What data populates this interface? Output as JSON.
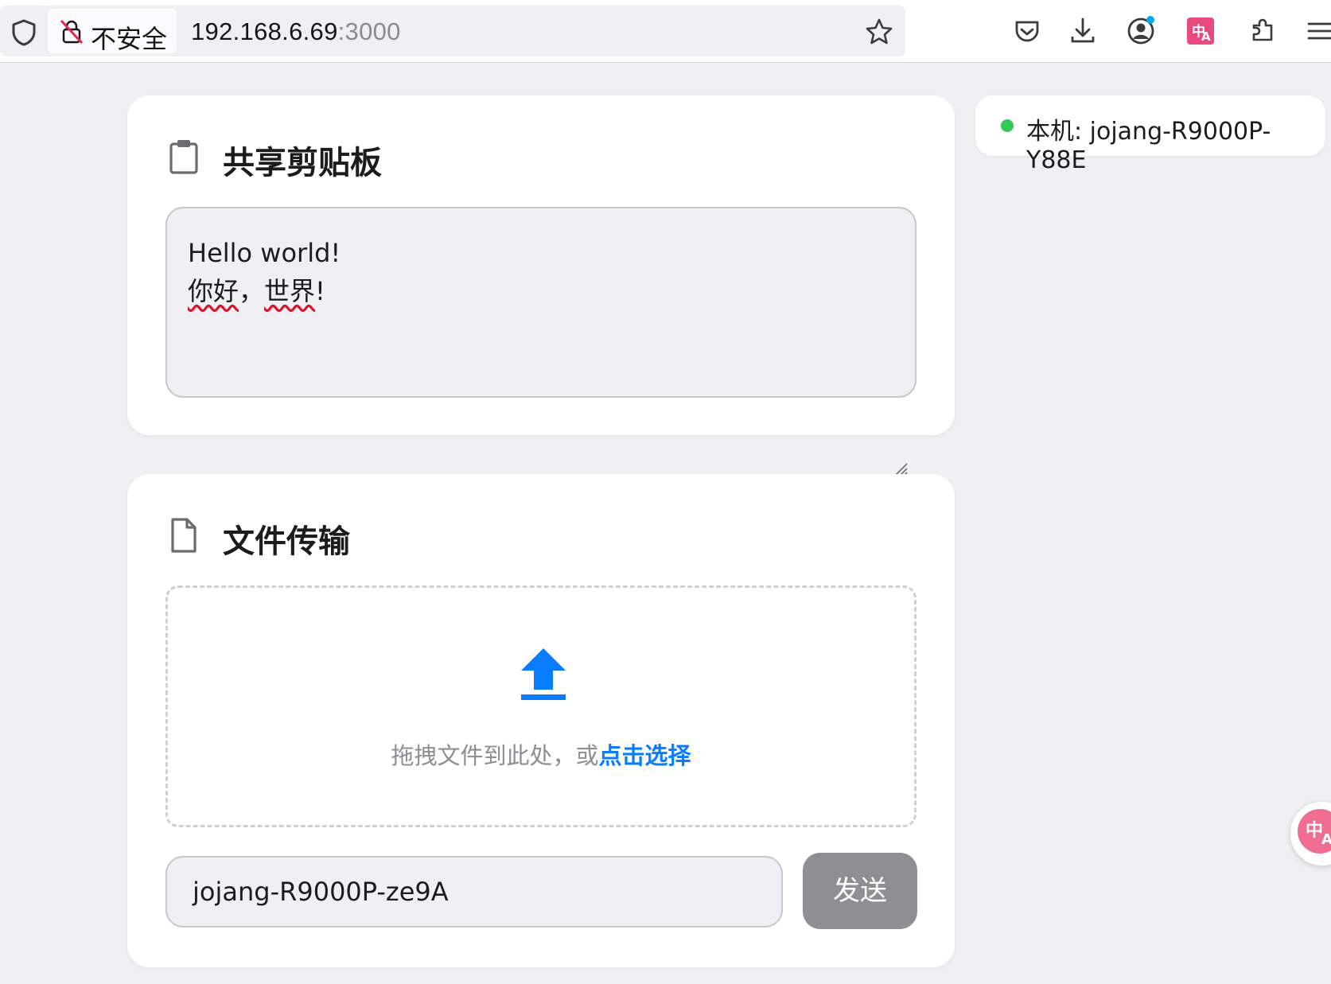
{
  "browser": {
    "security_label": "不安全",
    "url_host": "192.168.6.69",
    "url_port": ":3000"
  },
  "clipboard": {
    "title": "共享剪贴板",
    "text_line1": "Hello world!",
    "text_line2_a": "你好",
    "text_line2_b": "，",
    "text_line2_c": "世界",
    "text_line2_d": "!"
  },
  "file_transfer": {
    "title": "文件传输",
    "drop_prompt": "拖拽文件到此处，或",
    "drop_link": "点击选择",
    "target_device": "jojang-R9000P-ze9A",
    "send_label": "发送"
  },
  "host": {
    "label": "本机: jojang-R9000P-Y88E",
    "status_color": "#34c759"
  },
  "colors": {
    "accent": "#0a7cff",
    "button_disabled": "#8e8e93"
  }
}
